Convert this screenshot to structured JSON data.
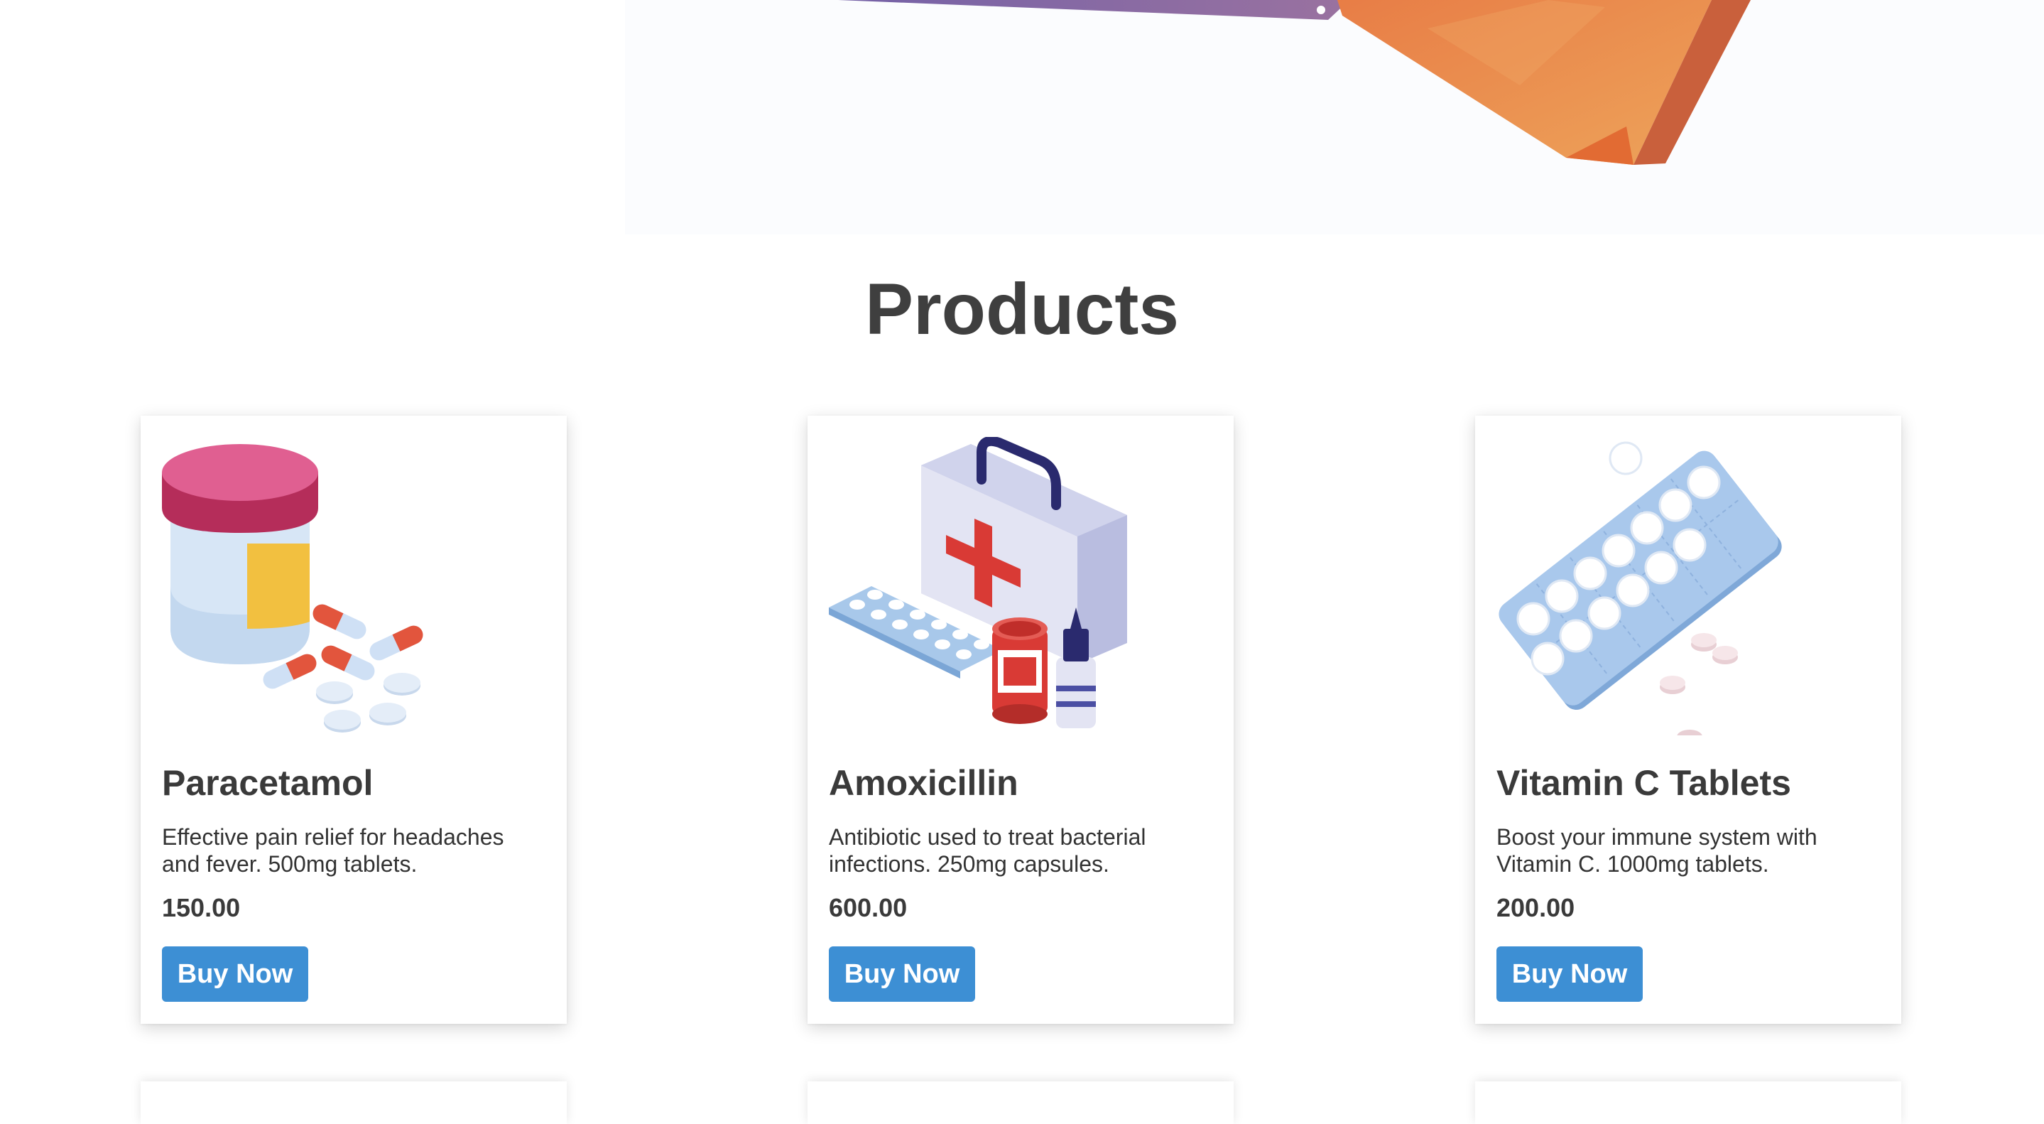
{
  "section": {
    "title": "Products"
  },
  "products": [
    {
      "name": "Paracetamol",
      "description": "Effective pain relief for headaches and fever. 500mg tablets.",
      "price": "150.00",
      "button_label": "Buy Now",
      "image_icon": "pill-jar-icon"
    },
    {
      "name": "Amoxicillin",
      "description": "Antibiotic used to treat bacterial infections. 250mg capsules.",
      "price": "600.00",
      "button_label": "Buy Now",
      "image_icon": "first-aid-kit-icon"
    },
    {
      "name": "Vitamin C Tablets",
      "description": "Boost your immune system with Vitamin C. 1000mg tablets.",
      "price": "200.00",
      "button_label": "Buy Now",
      "image_icon": "blister-pack-icon"
    }
  ],
  "colors": {
    "button": "#3d8fd4",
    "title": "#3f3f3f",
    "hero_orange": "#e8894a",
    "hero_purple": "#8a6aa8"
  }
}
